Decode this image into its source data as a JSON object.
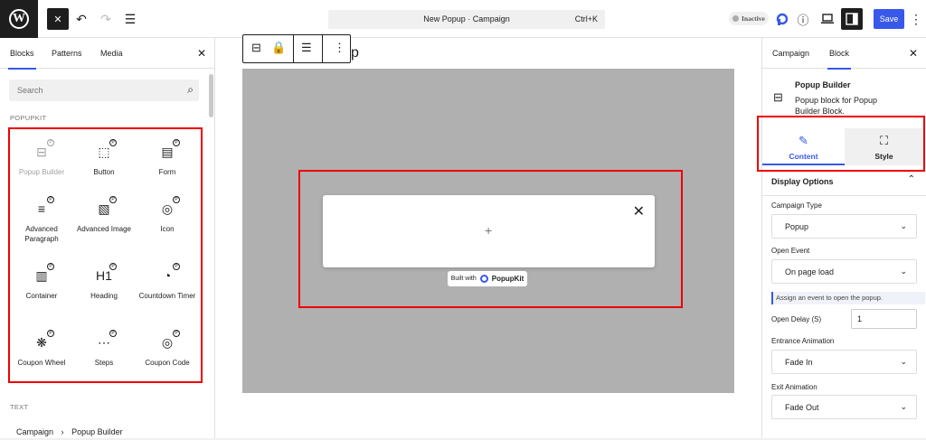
{
  "topbar": {
    "add_icon": "✕",
    "document_title": "New Popup · Campaign",
    "shortcut": "Ctrl+K",
    "status_badge": "Inactive",
    "save_label": "Save"
  },
  "left_panel": {
    "tabs": [
      "Blocks",
      "Patterns",
      "Media"
    ],
    "search_placeholder": "Search",
    "section_popupkit": "POPUPKIT",
    "section_text": "TEXT",
    "blocks": [
      {
        "label": "Popup Builder",
        "icon": "popup-builder-icon",
        "glyph": "⊟"
      },
      {
        "label": "Button",
        "icon": "button-icon",
        "glyph": "⬚"
      },
      {
        "label": "Form",
        "icon": "form-icon",
        "glyph": "▤"
      },
      {
        "label": "Advanced Paragraph",
        "icon": "advanced-paragraph-icon",
        "glyph": "≡"
      },
      {
        "label": "Advanced Image",
        "icon": "advanced-image-icon",
        "glyph": "▧"
      },
      {
        "label": "Icon",
        "icon": "icon-block-icon",
        "glyph": "◎"
      },
      {
        "label": "Container",
        "icon": "container-icon",
        "glyph": "▥"
      },
      {
        "label": "Heading",
        "icon": "heading-icon",
        "glyph": "H1"
      },
      {
        "label": "Countdown Timer",
        "icon": "countdown-timer-icon",
        "glyph": "◔"
      },
      {
        "label": "Coupon Wheel",
        "icon": "coupon-wheel-icon",
        "glyph": "❋"
      },
      {
        "label": "Steps",
        "icon": "steps-icon",
        "glyph": "⋯"
      },
      {
        "label": "Coupon Code",
        "icon": "coupon-code-icon",
        "glyph": "◎"
      }
    ],
    "breadcrumb": {
      "root": "Campaign",
      "separator": "›",
      "current": "Popup Builder"
    }
  },
  "canvas": {
    "popup_close": "✕",
    "popup_add": "+",
    "built_with": "Built with",
    "brand": "PopupKit",
    "heading_partial": "p"
  },
  "right_panel": {
    "tabs": [
      "Campaign",
      "Block"
    ],
    "block_title": "Popup Builder",
    "block_description": "Popup block for Popup Builder Block.",
    "content_tab": "Content",
    "style_tab": "Style",
    "display_options": "Display Options",
    "fields": {
      "campaign_type_label": "Campaign Type",
      "campaign_type_value": "Popup",
      "open_event_label": "Open Event",
      "open_event_value": "On page load",
      "open_event_help": "Assign an event to open the popup.",
      "open_delay_label": "Open Delay (S)",
      "open_delay_value": "1",
      "entrance_label": "Entrance Animation",
      "entrance_value": "Fade In",
      "exit_label": "Exit Animation",
      "exit_value": "Fade Out"
    }
  },
  "colors": {
    "accent": "#3858e9",
    "highlight": "#e00000",
    "canvas_gray": "#b0b0b0"
  }
}
